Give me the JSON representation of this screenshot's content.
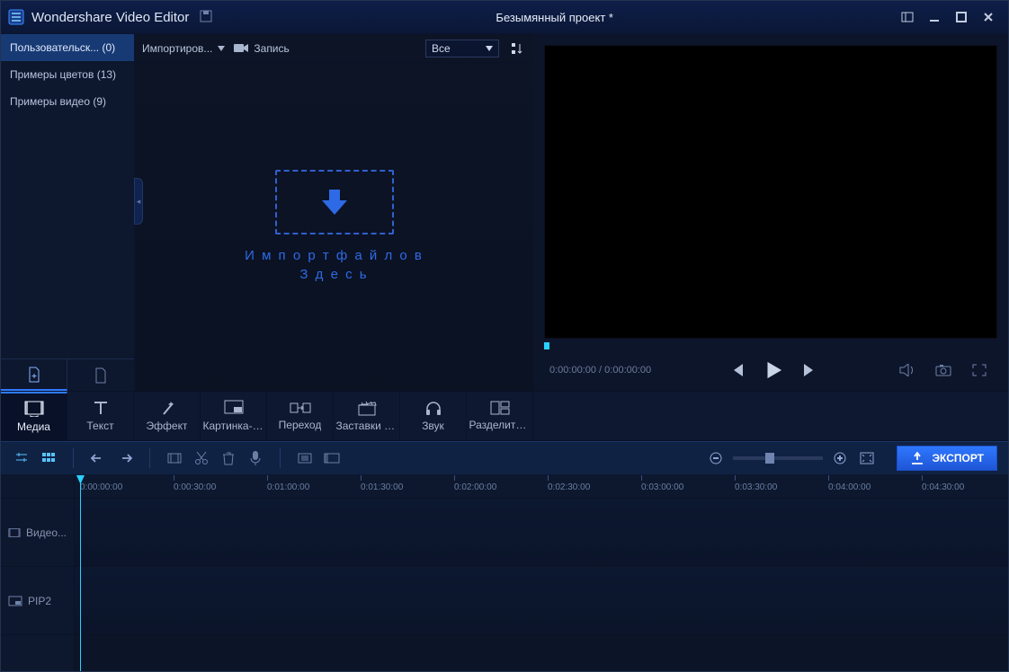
{
  "app": {
    "title": "Wondershare Video Editor",
    "project": "Безымянный проект *"
  },
  "sidebar": {
    "items": [
      {
        "label": "Пользовательск... (0)",
        "active": true
      },
      {
        "label": "Примеры цветов (13)",
        "active": false
      },
      {
        "label": "Примеры видео (9)",
        "active": false
      }
    ]
  },
  "media_toolbar": {
    "import": "Импортиров...",
    "record": "Запись",
    "filter_selected": "Все"
  },
  "dropzone": {
    "line1": "И м п о р т ф а й л о в",
    "line2": "З д е с ь"
  },
  "modules": [
    {
      "key": "media",
      "label": "Медиа"
    },
    {
      "key": "text",
      "label": "Текст"
    },
    {
      "key": "effect",
      "label": "Эффект"
    },
    {
      "key": "pip",
      "label": "Картинка-в..."
    },
    {
      "key": "trans",
      "label": "Переход"
    },
    {
      "key": "intro",
      "label": "Заставки и ..."
    },
    {
      "key": "sound",
      "label": "Звук"
    },
    {
      "key": "split",
      "label": "Разделить ..."
    }
  ],
  "preview": {
    "time_current": "0:00:00:00",
    "time_total": "0:00:00:00",
    "separator": " / "
  },
  "export": {
    "label": "ЭКСПОРТ"
  },
  "timeline": {
    "tracks": [
      {
        "label": "Видео..."
      },
      {
        "label": "PIP2"
      }
    ],
    "ticks": [
      "0:00:00:00",
      "0:00:30:00",
      "0:01:00:00",
      "0:01:30:00",
      "0:02:00:00",
      "0:02:30:00",
      "0:03:00:00",
      "0:03:30:00",
      "0:04:00:00",
      "0:04:30:00"
    ]
  }
}
